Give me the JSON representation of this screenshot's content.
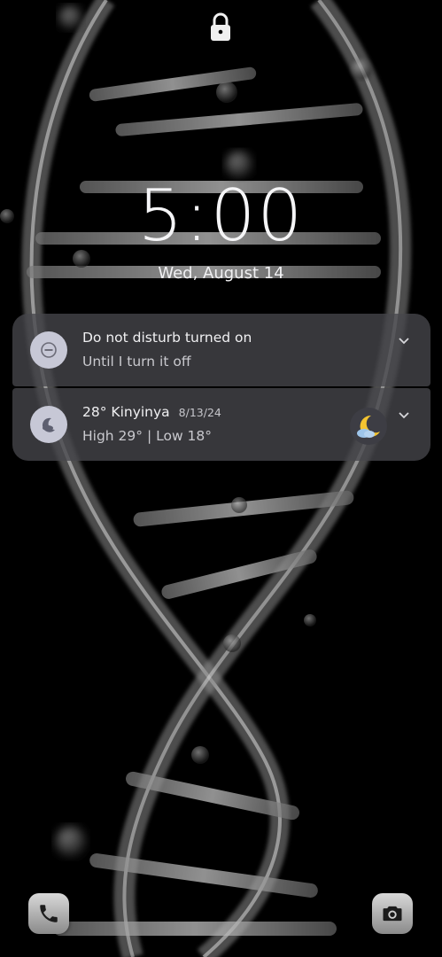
{
  "lockscreen": {
    "time": "5:00",
    "date": "Wed, August 14"
  },
  "notifications": [
    {
      "title": "Do not disturb turned on",
      "subtitle": "Until I turn it off",
      "icon": "do-not-disturb-icon"
    },
    {
      "title": "28° Kinyinya",
      "time": "8/13/24",
      "subtitle": "High 29° | Low 18°",
      "icon": "moon-icon",
      "badge_icon": "moon-cloud-icon"
    }
  ],
  "shortcuts": {
    "left": "phone-icon",
    "right": "camera-icon"
  },
  "colors": {
    "notification_bg": "#46464c",
    "icon_bg": "#c7c8d6",
    "moon": "#f4c430"
  }
}
